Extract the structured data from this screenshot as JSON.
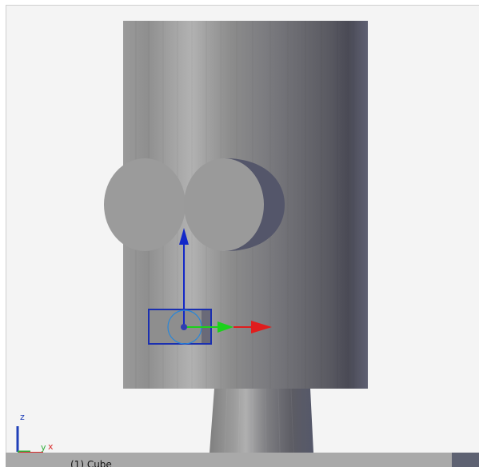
{
  "status_bar": {
    "object_label": "(1) Cube"
  },
  "axis_indicator": {
    "z_label": "z",
    "y_label": "y",
    "x_label": "x",
    "z_color": "#1f3fb8",
    "y_color": "#2fae3a",
    "x_color": "#d82b2b"
  },
  "gizmo": {
    "z_color": "#1328c8",
    "y_color": "#1bd11b",
    "x_color": "#e01d1d",
    "ring_color": "#2a86d8"
  },
  "icons": [
    "transform-gizmo-icon",
    "axis-orientation-icon"
  ]
}
